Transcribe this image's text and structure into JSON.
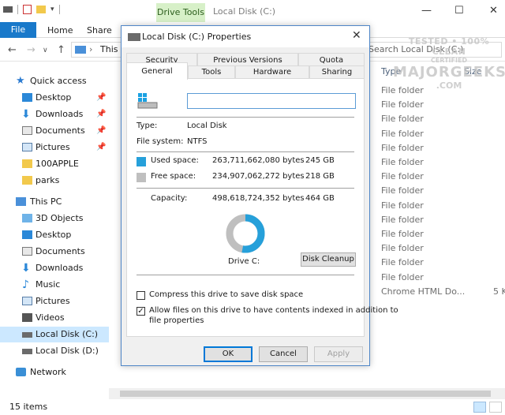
{
  "explorer": {
    "title": "Local Disk (C:)",
    "context_tab": "Drive Tools",
    "ribbon_tabs": [
      "File",
      "Home",
      "Share"
    ],
    "address": "This P",
    "search_placeholder": "Search Local Disk (C:)",
    "columns": {
      "type": "Type",
      "size": "Size"
    },
    "nav": {
      "quick_access": "Quick access",
      "quick_items": [
        "Desktop",
        "Downloads",
        "Documents",
        "Pictures",
        "100APPLE",
        "parks"
      ],
      "this_pc": "This PC",
      "pc_items": [
        "3D Objects",
        "Desktop",
        "Documents",
        "Downloads",
        "Music",
        "Pictures",
        "Videos",
        "Local Disk (C:)",
        "Local Disk (D:)"
      ],
      "network": "Network"
    },
    "rows": [
      {
        "type": "File folder"
      },
      {
        "type": "File folder"
      },
      {
        "type": "File folder"
      },
      {
        "type": "File folder"
      },
      {
        "type": "File folder"
      },
      {
        "type": "File folder"
      },
      {
        "type": "File folder"
      },
      {
        "type": "File folder"
      },
      {
        "type": "File folder"
      },
      {
        "type": "File folder"
      },
      {
        "type": "File folder"
      },
      {
        "type": "File folder"
      },
      {
        "type": "File folder"
      },
      {
        "type": "File folder"
      },
      {
        "type": "Chrome HTML Do...",
        "size": "5 K"
      }
    ],
    "status": "15 items"
  },
  "watermark": {
    "line1": "TESTED • 100% CLEAN",
    "line2": "MAJORGEEKS",
    "line3": "CERTIFIED",
    "line4": ".COM"
  },
  "dialog": {
    "title": "Local Disk (C:) Properties",
    "tabs_top": [
      "Security",
      "Previous Versions",
      "Quota"
    ],
    "tabs_bottom": [
      "General",
      "Tools",
      "Hardware",
      "Sharing"
    ],
    "drive_name_value": "",
    "type_label": "Type:",
    "type_value": "Local Disk",
    "fs_label": "File system:",
    "fs_value": "NTFS",
    "used_label": "Used space:",
    "used_bytes": "263,711,662,080 bytes",
    "used_size": "245 GB",
    "free_label": "Free space:",
    "free_bytes": "234,907,062,272 bytes",
    "free_size": "218 GB",
    "capacity_label": "Capacity:",
    "capacity_bytes": "498,618,724,352 bytes",
    "capacity_size": "464 GB",
    "used_fraction": 0.529,
    "drive_label": "Drive C:",
    "cleanup_button": "Disk Cleanup",
    "compress_label": "Compress this drive to save disk space",
    "compress_checked": false,
    "index_label_1": "Allow files on this drive to have contents indexed in addition to",
    "index_label_2": "file properties",
    "index_checked": true,
    "ok": "OK",
    "cancel": "Cancel",
    "apply": "Apply",
    "colors": {
      "used": "#26a0da",
      "free": "#bfbfbf"
    }
  }
}
